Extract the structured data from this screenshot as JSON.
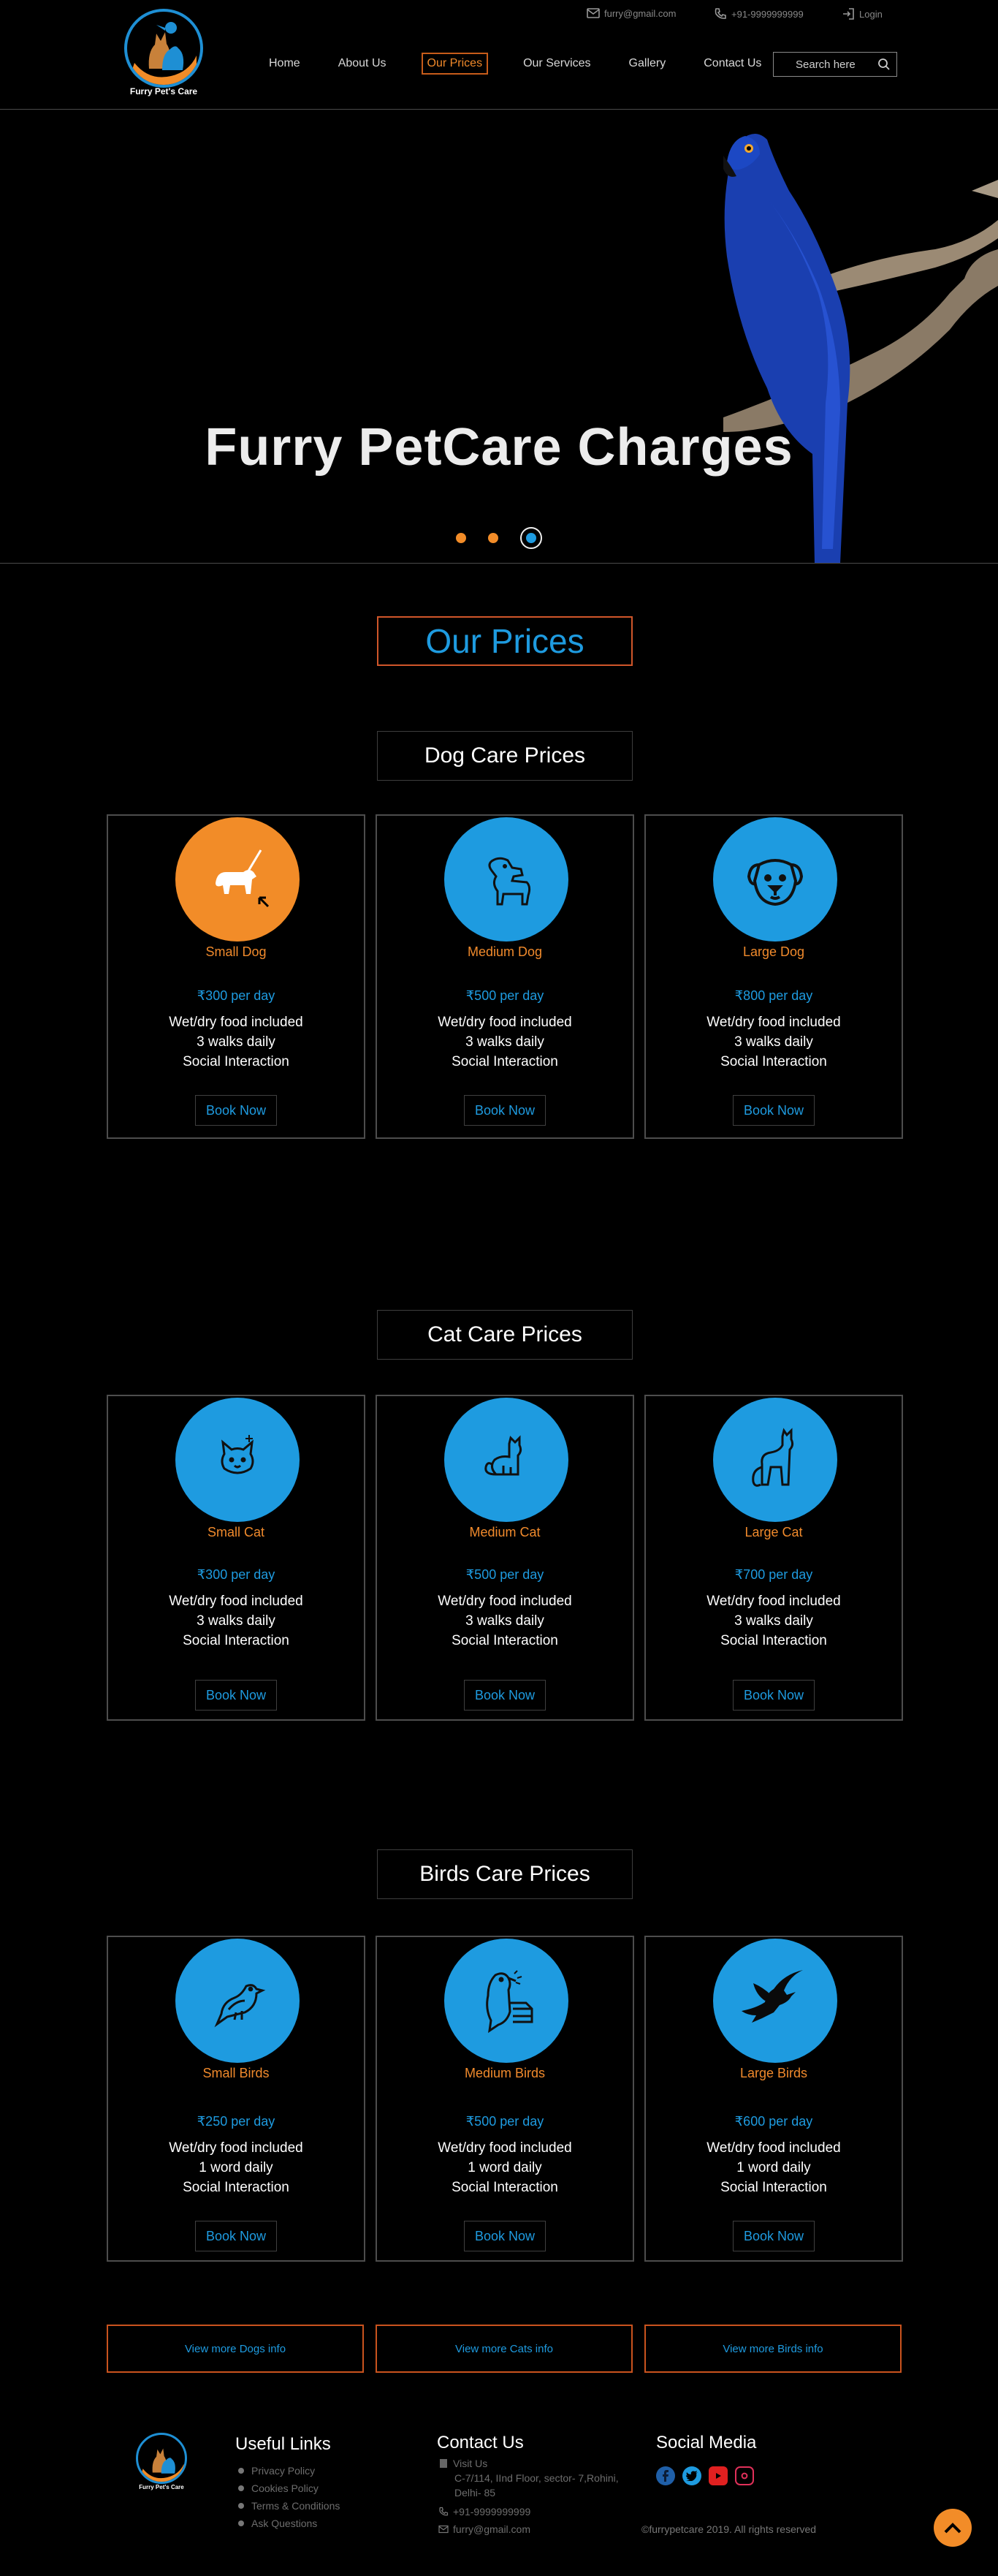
{
  "header": {
    "logo_text": "Furry Pet's Care",
    "email": "furry@gmail.com",
    "phone": "+91-9999999999",
    "login": "Login",
    "nav": [
      "Home",
      "About Us",
      "Our Prices",
      "Our Services",
      "Gallery",
      "Contact Us"
    ],
    "active_nav": "Our Prices",
    "search_placeholder": "Search here"
  },
  "hero": {
    "title": "Furry PetCare Charges",
    "slides_total": 3,
    "active_slide": 3
  },
  "prices_heading": "Our Prices",
  "sections": {
    "dog": {
      "title": "Dog Care Prices",
      "cards": [
        {
          "name": "Small Dog",
          "price": "₹300 per day",
          "lines": [
            "Wet/dry food included",
            "3 walks daily",
            "Social Interaction"
          ],
          "button": "Book Now",
          "icon": "small-dog-icon"
        },
        {
          "name": "Medium Dog",
          "price": "₹500 per day",
          "lines": [
            "Wet/dry food included",
            "3 walks daily",
            "Social Interaction"
          ],
          "button": "Book Now",
          "icon": "medium-dog-icon"
        },
        {
          "name": "Large Dog",
          "price": "₹800 per day",
          "lines": [
            "Wet/dry food included",
            "3 walks daily",
            "Social Interaction"
          ],
          "button": "Book Now",
          "icon": "large-dog-icon"
        }
      ]
    },
    "cat": {
      "title": "Cat Care Prices",
      "cards": [
        {
          "name": "Small Cat",
          "price": "₹300 per day",
          "lines": [
            "Wet/dry food included",
            "3 walks daily",
            "Social Interaction"
          ],
          "button": "Book Now",
          "icon": "small-cat-icon"
        },
        {
          "name": "Medium Cat",
          "price": "₹500 per day",
          "lines": [
            "Wet/dry food included",
            "3 walks daily",
            "Social Interaction"
          ],
          "button": "Book Now",
          "icon": "medium-cat-icon"
        },
        {
          "name": "Large Cat",
          "price": "₹700 per day",
          "lines": [
            "Wet/dry food included",
            "3 walks daily",
            "Social Interaction"
          ],
          "button": "Book Now",
          "icon": "large-cat-icon"
        }
      ]
    },
    "birds": {
      "title": "Birds Care Prices",
      "cards": [
        {
          "name": "Small Birds",
          "price": "₹250 per day",
          "lines": [
            "Wet/dry food included",
            "1 word daily",
            "Social Interaction"
          ],
          "button": "Book Now",
          "icon": "small-bird-icon"
        },
        {
          "name": "Medium Birds",
          "price": "₹500 per day",
          "lines": [
            "Wet/dry food included",
            "1 word daily",
            "Social Interaction"
          ],
          "button": "Book Now",
          "icon": "medium-bird-icon"
        },
        {
          "name": "Large Birds",
          "price": "₹600 per day",
          "lines": [
            "Wet/dry food included",
            "1 word daily",
            "Social Interaction"
          ],
          "button": "Book Now",
          "icon": "large-bird-icon"
        }
      ]
    }
  },
  "more_buttons": [
    "View more Dogs info",
    "View more Cats info",
    "View more Birds info"
  ],
  "footer": {
    "logo_text": "Furry Pet's Care",
    "useful_links_title": "Useful Links",
    "useful_links": [
      "Privacy Policy",
      "Cookies Policy",
      "Terms & Conditions",
      "Ask Questions"
    ],
    "contact_title": "Contact Us",
    "visit_label": "Visit Us",
    "address_lines": [
      "C-7/114, IInd Floor, sector- 7,Rohini,",
      "Delhi- 85"
    ],
    "phone": "+91-9999999999",
    "email": "furry@gmail.com",
    "social_title": "Social Media",
    "copyright": "©furrypetcare 2019. All rights reserved"
  },
  "colors": {
    "accent_blue": "#1e9be0",
    "accent_orange": "#f28c28",
    "bg": "#000000"
  }
}
